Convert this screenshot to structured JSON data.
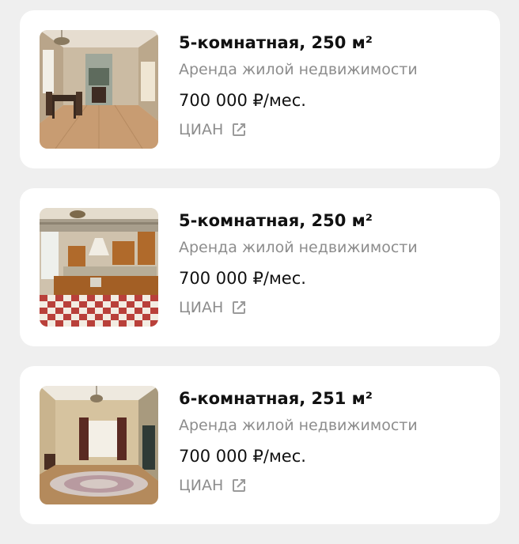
{
  "listings": [
    {
      "title": "5-комнатная, 250 м²",
      "subtitle": "Аренда жилой недвижимости",
      "price": "700 000 ₽/мес.",
      "source": "ЦИАН",
      "photo": "interior-living-room-fireplace",
      "link_icon": "external-link-icon"
    },
    {
      "title": "5-комнатная, 250 м²",
      "subtitle": "Аренда жилой недвижимости",
      "price": "700 000 ₽/мес.",
      "source": "ЦИАН",
      "photo": "interior-kitchen-checkered-floor",
      "link_icon": "external-link-icon"
    },
    {
      "title": "6-комнатная, 251 м²",
      "subtitle": "Аренда жилой недвижимости",
      "price": "700 000 ₽/мес.",
      "source": "ЦИАН",
      "photo": "interior-living-room-carpet",
      "link_icon": "external-link-icon"
    }
  ],
  "colors": {
    "background": "#efefef",
    "card": "#ffffff",
    "title": "#111111",
    "muted": "#8d8d8d"
  }
}
